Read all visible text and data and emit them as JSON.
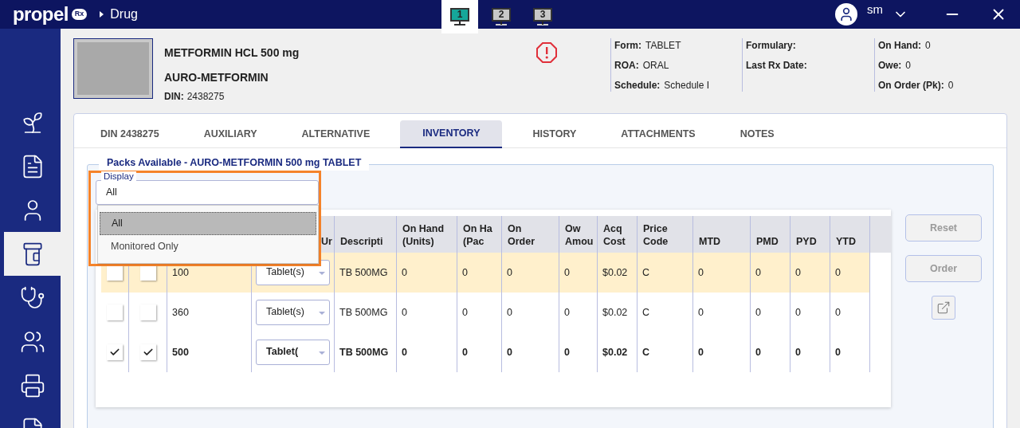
{
  "top_bar": {
    "logo": "propel",
    "logo_badge": "Rx",
    "breadcrumb": "Drug",
    "workspaces": [
      {
        "label": "1",
        "selected": true
      },
      {
        "label": "2",
        "selected": false
      },
      {
        "label": "3",
        "selected": false
      }
    ],
    "user": "sm"
  },
  "sidebar": {
    "items": [
      {
        "selected": false
      },
      {
        "selected": false
      },
      {
        "selected": false
      },
      {
        "selected": true
      },
      {
        "selected": false
      },
      {
        "selected": false
      },
      {
        "selected": false
      },
      {
        "selected": false
      }
    ]
  },
  "drug": {
    "name": "METFORMIN HCL 500 mg",
    "brand": "AURO-METFORMIN",
    "din_label": "DIN:",
    "din": "2438275",
    "info_columns": [
      [
        {
          "label": "Form:",
          "value": "TABLET"
        },
        {
          "label": "ROA:",
          "value": "ORAL"
        },
        {
          "label": "Schedule:",
          "value": "Schedule I"
        }
      ],
      [
        {
          "label": "Formulary:"
        },
        {
          "label": "Last Rx Date:"
        }
      ],
      [
        {
          "label": "On Hand:",
          "value": "0"
        },
        {
          "label": "Owe:",
          "value": "0"
        },
        {
          "label": "On Order (Pk):",
          "value": "0"
        }
      ]
    ]
  },
  "tabs": [
    {
      "label": "DIN 2438275",
      "selected": false
    },
    {
      "label": "AUXILIARY",
      "selected": false
    },
    {
      "label": "ALTERNATIVE",
      "selected": false
    },
    {
      "label": "INVENTORY",
      "selected": true
    },
    {
      "label": "HISTORY",
      "selected": false
    },
    {
      "label": "ATTACHMENTS",
      "selected": false
    },
    {
      "label": "NOTES",
      "selected": false
    }
  ],
  "packs_panel": {
    "title": "Packs Available - AURO-METFORMIN 500 mg TABLET",
    "display": {
      "label": "Display",
      "value": "All",
      "options": [
        {
          "label": "All",
          "selected": true
        },
        {
          "label": "Monitored Only",
          "selected": false
        }
      ]
    },
    "table": {
      "unit_column": "Ur",
      "columns": [
        "Descripti",
        "On Hand (Units)",
        "On Ha (Pac",
        "On Order",
        "Ow Amou",
        "Acq Cost",
        "Price Code",
        "MTD",
        "PMD",
        "PYD",
        "YTD"
      ],
      "rows": [
        {
          "highlighted": true,
          "bold": false,
          "checks": [
            false,
            false
          ],
          "pack": "100",
          "unit": "Tablet(s)",
          "cells": [
            "TB 500MG",
            "0",
            "0",
            "0",
            "0",
            "$0.02",
            "C",
            "0",
            "0",
            "0",
            "0"
          ]
        },
        {
          "highlighted": false,
          "bold": false,
          "checks": [
            false,
            false
          ],
          "pack": "360",
          "unit": "Tablet(s)",
          "cells": [
            "TB 500MG",
            "0",
            "0",
            "0",
            "0",
            "$0.02",
            "C",
            "0",
            "0",
            "0",
            "0"
          ]
        },
        {
          "highlighted": false,
          "bold": true,
          "checks": [
            true,
            true
          ],
          "pack": "500",
          "unit": "Tablet(",
          "cells": [
            "TB 500MG",
            "0",
            "0",
            "0",
            "0",
            "$0.02",
            "C",
            "0",
            "0",
            "0",
            "0"
          ]
        }
      ]
    },
    "buttons": [
      {
        "label": "Reset",
        "disabled": true
      },
      {
        "label": "Order",
        "disabled": true
      }
    ]
  }
}
